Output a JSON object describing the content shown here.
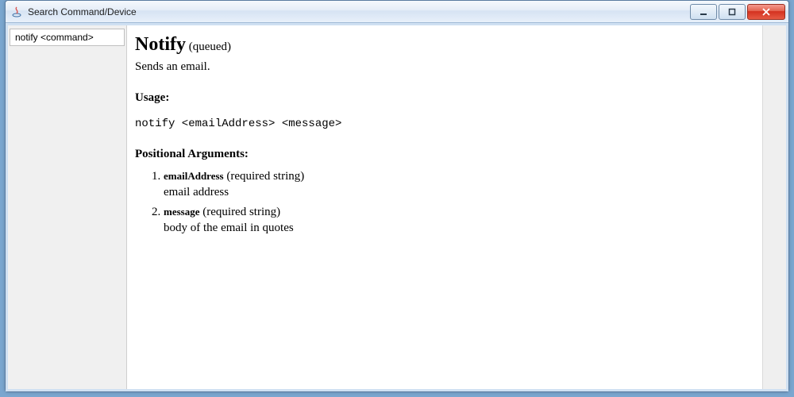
{
  "window": {
    "title": "Search Command/Device"
  },
  "sidebar": {
    "items": [
      {
        "label": "notify <command>"
      }
    ]
  },
  "doc": {
    "command_title": "Notify",
    "command_note": "(queued)",
    "description": "Sends an email.",
    "usage_heading": "Usage:",
    "usage_line": "notify <emailAddress> <message>",
    "args_heading": "Positional Arguments:",
    "args": [
      {
        "name": "emailAddress",
        "meta": "(required string)",
        "desc": "email address"
      },
      {
        "name": "message",
        "meta": "(required string)",
        "desc": "body of the email in quotes"
      }
    ]
  }
}
